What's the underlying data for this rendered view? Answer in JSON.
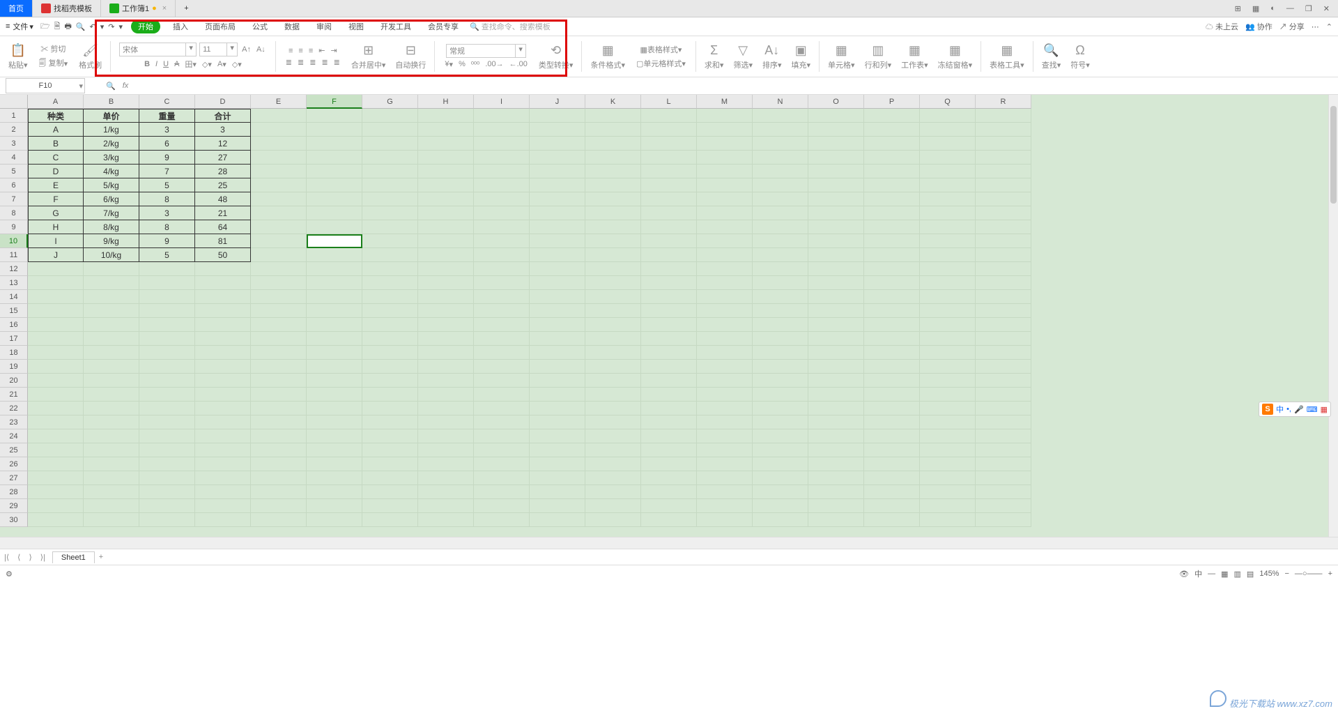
{
  "tabs": {
    "home": "首页",
    "t2": "找稻壳模板",
    "t3": "工作簿1",
    "plus": "+",
    "modified": "●",
    "close": "×"
  },
  "winctl": {
    "layout": "⊞",
    "grid": "▦",
    "user": "◐",
    "min": "—",
    "max": "❐",
    "close": "✕"
  },
  "menu": {
    "file": "文件",
    "hamburger": "≡",
    "dd": "▾",
    "q": {
      "open": "🗁",
      "saveas": "🗎",
      "print": "🖶",
      "find": "🔍",
      "undo": "↶",
      "redo": "↷",
      "dd": "▾"
    },
    "tabs": {
      "start": "开始",
      "insert": "插入",
      "layout": "页面布局",
      "formula": "公式",
      "data": "数据",
      "review": "审阅",
      "view": "视图",
      "dev": "开发工具",
      "vip": "会员专享"
    },
    "search": "🔍 查找命令、搜索模板",
    "cloud": "☁ 未上云",
    "collab": "👥 协作",
    "share": "↗ 分享",
    "more": "⋯",
    "fold": "⌃"
  },
  "ribbon": {
    "paste": "粘贴",
    "cut": "✂ 剪切",
    "copy": "🗐 复制",
    "brush": "格式刷",
    "fontname": "宋体",
    "fontsize": "11",
    "ai": "A↑",
    "ad": "A↓",
    "b": "B",
    "i": "I",
    "u": "U",
    "a1": "A",
    "border": "田",
    "fill": "◇",
    "fontcolor": "A",
    "clear": "◇",
    "al1": "≡",
    "al2": "≡",
    "al3": "≡",
    "ind1": "⇤",
    "ind2": "⇥",
    "al4": "≣",
    "al5": "≣",
    "al6": "≣",
    "al7": "≣",
    "al8": "≣",
    "merge": "合并居中",
    "mergeico": "⊞",
    "wrap": "自动换行",
    "wrapico": "⊟",
    "numfmt": "常规",
    "cur": "¥",
    "pct": "%",
    "comma": "ᵒᵒᵒ",
    "dec1": ".00→",
    "dec2": "←.00",
    "convert": "类型转换",
    "convertico": "⟲",
    "cond": "条件格式",
    "condico": "▦",
    "tstyle": "表格样式",
    "cstyle": "单元格样式",
    "sum": "求和",
    "sumico": "Σ",
    "filter": "筛选",
    "filterico": "▽",
    "sort": "排序",
    "sortico": "A↓",
    "filldown": "填充",
    "fillico": "▣",
    "cell": "单元格",
    "cellico": "▦",
    "rowcol": "行和列",
    "rowcolico": "▥",
    "ws": "工作表",
    "wsico": "▦",
    "freeze": "冻结窗格",
    "freezeico": "▦",
    "ttool": "表格工具",
    "ttoolico": "▦",
    "find": "查找",
    "findico": "🔍",
    "symbol": "符号",
    "symbolico": "Ω",
    "dd": "▾",
    "dd2": "▾"
  },
  "cellref": "F10",
  "fx": "fx",
  "cols": [
    "A",
    "B",
    "C",
    "D",
    "E",
    "F",
    "G",
    "H",
    "I",
    "J",
    "K",
    "L",
    "M",
    "N",
    "O",
    "P",
    "Q",
    "R"
  ],
  "rows": 30,
  "selected": {
    "col": 5,
    "row": 9
  },
  "table": {
    "headers": [
      "种类",
      "单价",
      "重量",
      "合计"
    ],
    "data": [
      [
        "A",
        "1/kg",
        "3",
        "3"
      ],
      [
        "B",
        "2/kg",
        "6",
        "12"
      ],
      [
        "C",
        "3/kg",
        "9",
        "27"
      ],
      [
        "D",
        "4/kg",
        "7",
        "28"
      ],
      [
        "E",
        "5/kg",
        "5",
        "25"
      ],
      [
        "F",
        "6/kg",
        "8",
        "48"
      ],
      [
        "G",
        "7/kg",
        "3",
        "21"
      ],
      [
        "H",
        "8/kg",
        "8",
        "64"
      ],
      [
        "I",
        "9/kg",
        "9",
        "81"
      ],
      [
        "J",
        "10/kg",
        "5",
        "50"
      ]
    ]
  },
  "sheettab": {
    "name": "Sheet1",
    "plus": "+",
    "first": "|⟨",
    "prev": "⟨",
    "next": "⟩",
    "last": "⟩|"
  },
  "status": {
    "ready": "⚙",
    "eye": "👁",
    "zh": "中",
    "dash": "—",
    "v1": "▦",
    "v2": "▥",
    "v3": "▤",
    "zoom": "145%",
    "minus": "−",
    "plus": "+",
    "slider": "—○——"
  },
  "ime": {
    "logo": "S",
    "zh": "中",
    "punct": "•,",
    "mic": "🎤",
    "kb": "⌨",
    "grid": "▦"
  },
  "watermark": "极光下载站  www.xz7.com"
}
